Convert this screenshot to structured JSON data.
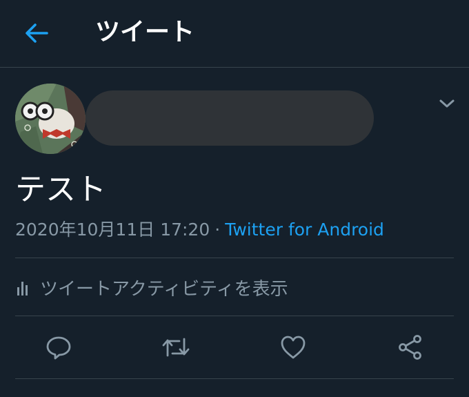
{
  "header": {
    "title": "ツイート"
  },
  "tweet": {
    "text": "テスト",
    "date": "2020年10月11日 17:20",
    "separator": "·",
    "source": "Twitter for Android"
  },
  "activity": {
    "label": "ツイートアクティビティを表示"
  },
  "icons": {
    "back": "back-arrow-icon",
    "more": "chevron-down-icon",
    "reply": "reply-icon",
    "retweet": "retweet-icon",
    "like": "like-icon",
    "share": "share-icon",
    "activity": "bar-chart-icon"
  },
  "colors": {
    "background": "#15202b",
    "accent": "#1da1f2",
    "secondary_text": "#8899a6",
    "divider": "#38444d"
  }
}
